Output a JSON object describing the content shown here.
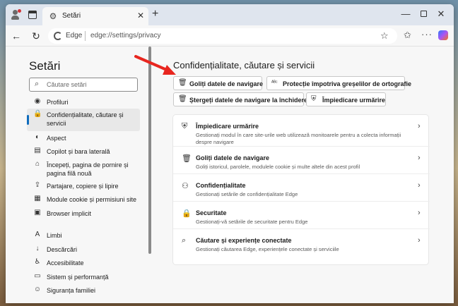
{
  "tab": {
    "title": "Setări"
  },
  "address": {
    "label": "Edge",
    "url": "edge://settings/privacy"
  },
  "sidebar": {
    "title": "Setări",
    "search_placeholder": "Căutare setări",
    "items": [
      {
        "label": "Profiluri",
        "icon": "profile-icon"
      },
      {
        "label": "Confidențialitate, căutare și\nservicii",
        "icon": "lock-icon"
      },
      {
        "label": "Aspect",
        "icon": "appearance-icon"
      },
      {
        "label": "Copilot și bara laterală",
        "icon": "sidebar-icon"
      },
      {
        "label": "Începeți, pagina de pornire și\npagina filă nouă",
        "icon": "home-icon"
      },
      {
        "label": "Partajare, copiere și lipire",
        "icon": "share-icon"
      },
      {
        "label": "Module cookie și permisiuni site",
        "icon": "cookie-icon"
      },
      {
        "label": "Browser implicit",
        "icon": "browser-icon"
      },
      {
        "label": "Limbi",
        "icon": "language-icon"
      },
      {
        "label": "Descărcări",
        "icon": "download-icon"
      },
      {
        "label": "Accesibilitate",
        "icon": "accessibility-icon"
      },
      {
        "label": "Sistem și performanță",
        "icon": "system-icon"
      },
      {
        "label": "Siguranța familiei",
        "icon": "family-icon"
      }
    ]
  },
  "main": {
    "title": "Confidențialitate, căutare și servicii",
    "quick_buttons": [
      {
        "label": "Goliți datele de navigare",
        "icon": "trash-icon"
      },
      {
        "label": "Protecție împotriva greșelilor de ortografie",
        "icon": "spellcheck-icon"
      },
      {
        "label": "Ștergeți datele de navigare la închidere",
        "icon": "trash-clock-icon"
      },
      {
        "label": "Împiedicare urmărire",
        "icon": "tracking-icon"
      }
    ],
    "rows": [
      {
        "title": "Împiedicare urmărire",
        "desc": "Gestionați modul în care site-urile web utilizează monitoarele pentru a colecta informații despre navigare",
        "icon": "tracking-icon"
      },
      {
        "title": "Goliți datele de navigare",
        "desc": "Goliți istoricul, parolele, modulele cookie și multe altele din acest profil",
        "icon": "trash-icon"
      },
      {
        "title": "Confidențialitate",
        "desc": "Gestionați setările de confidențialitate Edge",
        "icon": "privacy-icon"
      },
      {
        "title": "Securitate",
        "desc": "Gestionați-vă setările de securitate pentru Edge",
        "icon": "lock-icon"
      },
      {
        "title": "Căutare și experiențe conectate",
        "desc": "Gestionați căutarea Edge, experiențele conectate și serviciile",
        "icon": "search-icon"
      }
    ]
  },
  "colors": {
    "accent": "#0f6cbd",
    "arrow": "#e8261f"
  }
}
